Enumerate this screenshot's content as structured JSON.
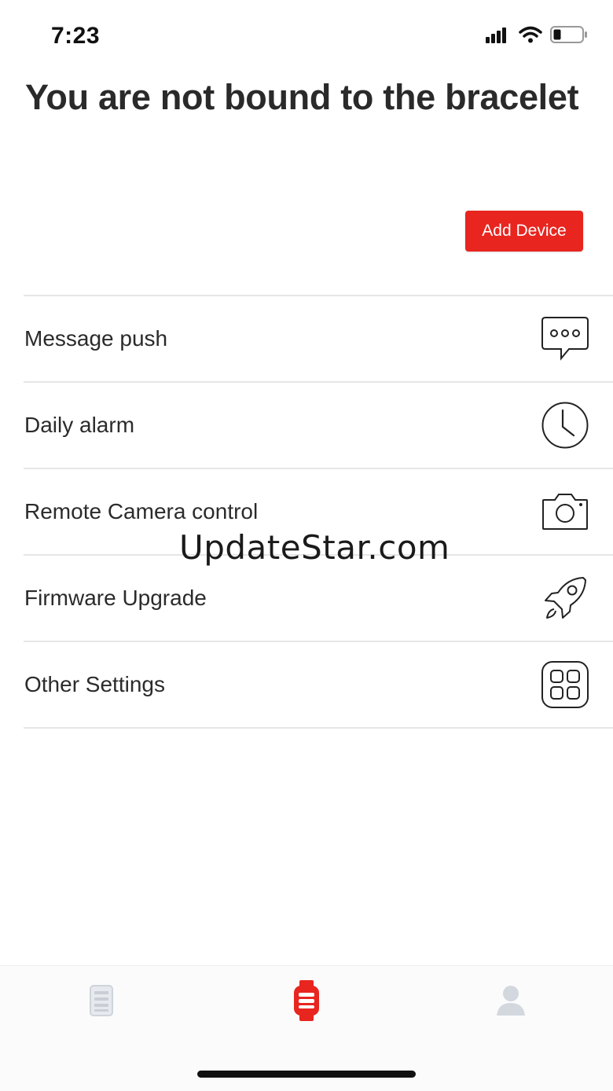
{
  "status_bar": {
    "time": "7:23",
    "signal_icon": "cellular-signal-icon",
    "wifi_icon": "wifi-icon",
    "battery_icon": "battery-low-icon"
  },
  "header": {
    "title": "You are not bound to the bracelet"
  },
  "add_device": {
    "label": "Add Device",
    "color": "#e8251f"
  },
  "menu": {
    "items": [
      {
        "label": "Message push",
        "icon": "message-bubble-icon"
      },
      {
        "label": "Daily alarm",
        "icon": "clock-icon"
      },
      {
        "label": "Remote Camera control",
        "icon": "camera-icon"
      },
      {
        "label": "Firmware Upgrade",
        "icon": "rocket-icon"
      },
      {
        "label": "Other Settings",
        "icon": "grid-icon"
      }
    ]
  },
  "watermark": {
    "text": "UpdateStar.com"
  },
  "tab_bar": {
    "tabs": [
      {
        "icon": "list-document-icon",
        "active": false
      },
      {
        "icon": "watch-icon",
        "active": true
      },
      {
        "icon": "user-profile-icon",
        "active": false
      }
    ],
    "active_color": "#e8251f",
    "inactive_color": "#d0d4da"
  }
}
